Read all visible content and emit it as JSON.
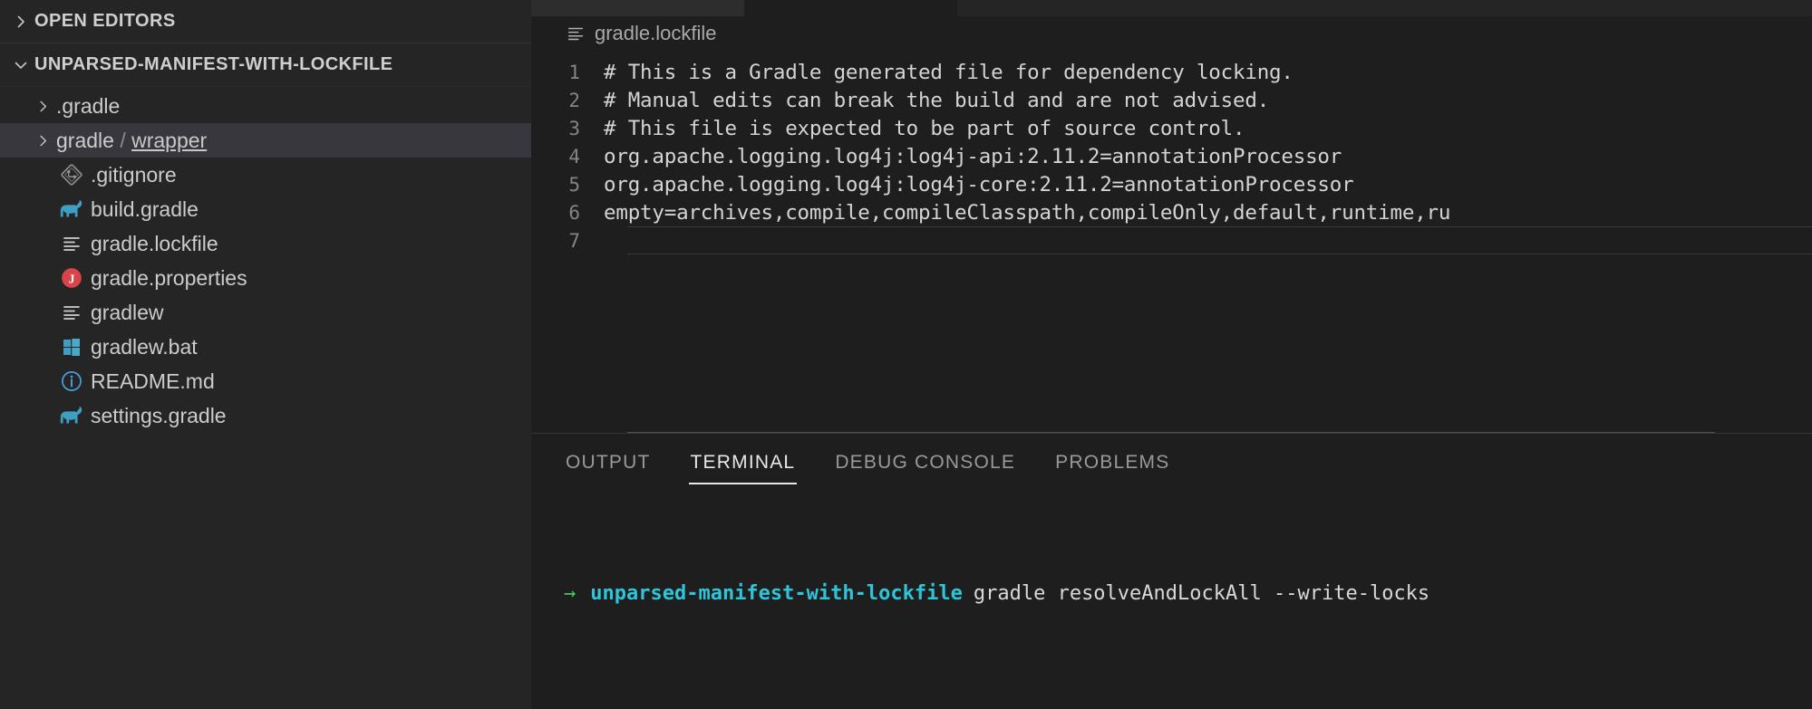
{
  "sidebar": {
    "sections": [
      {
        "label": "OPEN EDITORS",
        "twisty": "chevron-right-icon",
        "expanded": false
      },
      {
        "label": "UNPARSED-MANIFEST-WITH-LOCKFILE",
        "twisty": "chevron-down-icon",
        "expanded": true
      }
    ],
    "tree": [
      {
        "label": ".gradle",
        "type": "folder",
        "icon": "chevron-right-icon",
        "selected": false,
        "description": ""
      },
      {
        "label": "gradle",
        "type": "folder",
        "icon": "chevron-right-icon",
        "selected": true,
        "description": "wrapper",
        "separator": "/"
      },
      {
        "label": ".gitignore",
        "type": "file",
        "icon": "git-icon",
        "selected": false
      },
      {
        "label": "build.gradle",
        "type": "file",
        "icon": "gradle-elephant-icon",
        "selected": false
      },
      {
        "label": "gradle.lockfile",
        "type": "file",
        "icon": "text-lines-icon",
        "selected": false
      },
      {
        "label": "gradle.properties",
        "type": "file",
        "icon": "java-properties-icon",
        "selected": false
      },
      {
        "label": "gradlew",
        "type": "file",
        "icon": "text-lines-icon",
        "selected": false
      },
      {
        "label": "gradlew.bat",
        "type": "file",
        "icon": "windows-icon",
        "selected": false
      },
      {
        "label": "README.md",
        "type": "file",
        "icon": "info-circle-icon",
        "selected": false
      },
      {
        "label": "settings.gradle",
        "type": "file",
        "icon": "gradle-elephant-icon",
        "selected": false
      }
    ]
  },
  "editor": {
    "breadcrumb": {
      "file": "gradle.lockfile",
      "icon": "text-lines-icon"
    },
    "lines": [
      {
        "number": "1",
        "text": "# This is a Gradle generated file for dependency locking."
      },
      {
        "number": "2",
        "text": "# Manual edits can break the build and are not advised."
      },
      {
        "number": "3",
        "text": "# This file is expected to be part of source control."
      },
      {
        "number": "4",
        "text": "org.apache.logging.log4j:log4j-api:2.11.2=annotationProcessor"
      },
      {
        "number": "5",
        "text": "org.apache.logging.log4j:log4j-core:2.11.2=annotationProcessor"
      },
      {
        "number": "6",
        "text": "empty=archives,compile,compileClasspath,compileOnly,default,runtime,ru"
      },
      {
        "number": "7",
        "text": ""
      }
    ]
  },
  "panel": {
    "tabs": [
      {
        "label": "OUTPUT",
        "active": false
      },
      {
        "label": "TERMINAL",
        "active": true
      },
      {
        "label": "DEBUG CONSOLE",
        "active": false
      },
      {
        "label": "PROBLEMS",
        "active": false
      }
    ],
    "terminal": {
      "prompt_arrow": "→",
      "cwd": "unparsed-manifest-with-lockfile",
      "command": "gradle resolveAndLockAll --write-locks"
    }
  },
  "colors": {
    "sidebar_bg": "#252526",
    "editor_bg": "#1e1e1e",
    "selection_bg": "#37373d",
    "accent_cyan": "#2ec5d9",
    "accent_green": "#3fc95e",
    "gradle_blue": "#3f9fc1",
    "properties_red": "#d9434a"
  }
}
